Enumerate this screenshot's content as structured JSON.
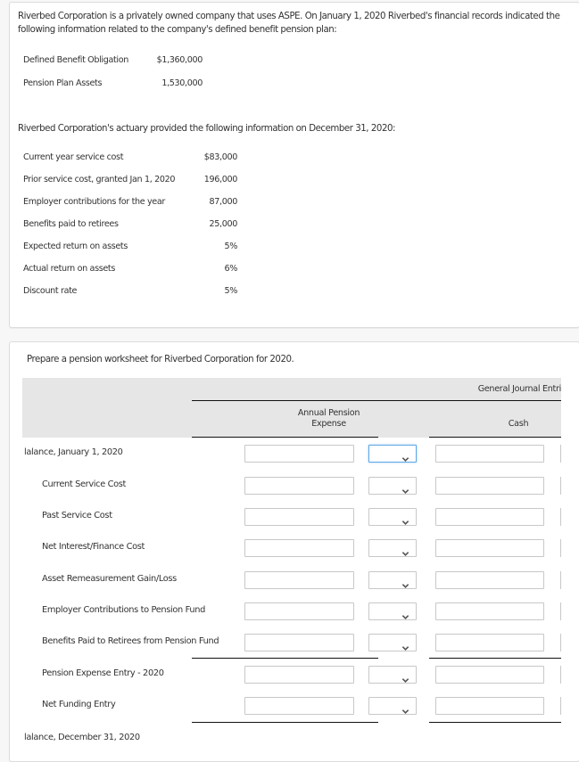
{
  "intro": {
    "paragraph": "Riverbed Corporation is a privately owned company that uses ASPE. On January 1, 2020 Riverbed's financial records indicated the following information related to the company's defined benefit pension plan:",
    "items": [
      {
        "label": "Defined Benefit Obligation",
        "value": "$1,360,000"
      },
      {
        "label": "Pension Plan Assets",
        "value": "1,530,000"
      }
    ],
    "actuary_paragraph": "Riverbed Corporation's actuary provided the following information on December 31, 2020:",
    "actuary_items": [
      {
        "label": "Current year service cost",
        "value": "$83,000"
      },
      {
        "label": "Prior service cost, granted Jan 1, 2020",
        "value": "196,000"
      },
      {
        "label": "Employer contributions for the year",
        "value": "87,000"
      },
      {
        "label": "Benefits paid to retirees",
        "value": "25,000"
      },
      {
        "label": "Expected return on assets",
        "value": "5%"
      },
      {
        "label": "Actual return on assets",
        "value": "6%"
      },
      {
        "label": "Discount rate",
        "value": "5%"
      }
    ]
  },
  "worksheet": {
    "instruction": "Prepare a pension worksheet for Riverbed Corporation for 2020.",
    "group_header": "General Journal Entri",
    "columns": [
      {
        "line1": "Annual Pension",
        "line2": "Expense"
      },
      {
        "line1": "",
        "line2": "Cash"
      }
    ],
    "rows": [
      {
        "label": "lalance, January 1, 2020",
        "indent": false,
        "has_inputs": true,
        "expense": "",
        "expense_dc": "",
        "cash": ""
      },
      {
        "label": "Current Service Cost",
        "indent": true,
        "has_inputs": true,
        "expense": "",
        "expense_dc": "",
        "cash": ""
      },
      {
        "label": "Past Service Cost",
        "indent": true,
        "has_inputs": true,
        "expense": "",
        "expense_dc": "",
        "cash": ""
      },
      {
        "label": "Net Interest/Finance Cost",
        "indent": true,
        "has_inputs": true,
        "expense": "",
        "expense_dc": "",
        "cash": ""
      },
      {
        "label": "Asset Remeasurement Gain/Loss",
        "indent": true,
        "has_inputs": true,
        "expense": "",
        "expense_dc": "",
        "cash": ""
      },
      {
        "label": "Employer Contributions to Pension Fund",
        "indent": true,
        "has_inputs": true,
        "expense": "",
        "expense_dc": "",
        "cash": ""
      },
      {
        "label": "Benefits Paid to Retirees from Pension Fund",
        "indent": true,
        "has_inputs": true,
        "expense": "",
        "expense_dc": "",
        "cash": ""
      },
      {
        "label": "Pension Expense Entry - 2020",
        "indent": true,
        "has_inputs": true,
        "expense": "",
        "expense_dc": "",
        "cash": ""
      },
      {
        "label": "Net Funding Entry",
        "indent": true,
        "has_inputs": true,
        "expense": "",
        "expense_dc": "",
        "cash": ""
      },
      {
        "label": "lalance, December 31, 2020",
        "indent": false,
        "has_inputs": false
      }
    ]
  }
}
